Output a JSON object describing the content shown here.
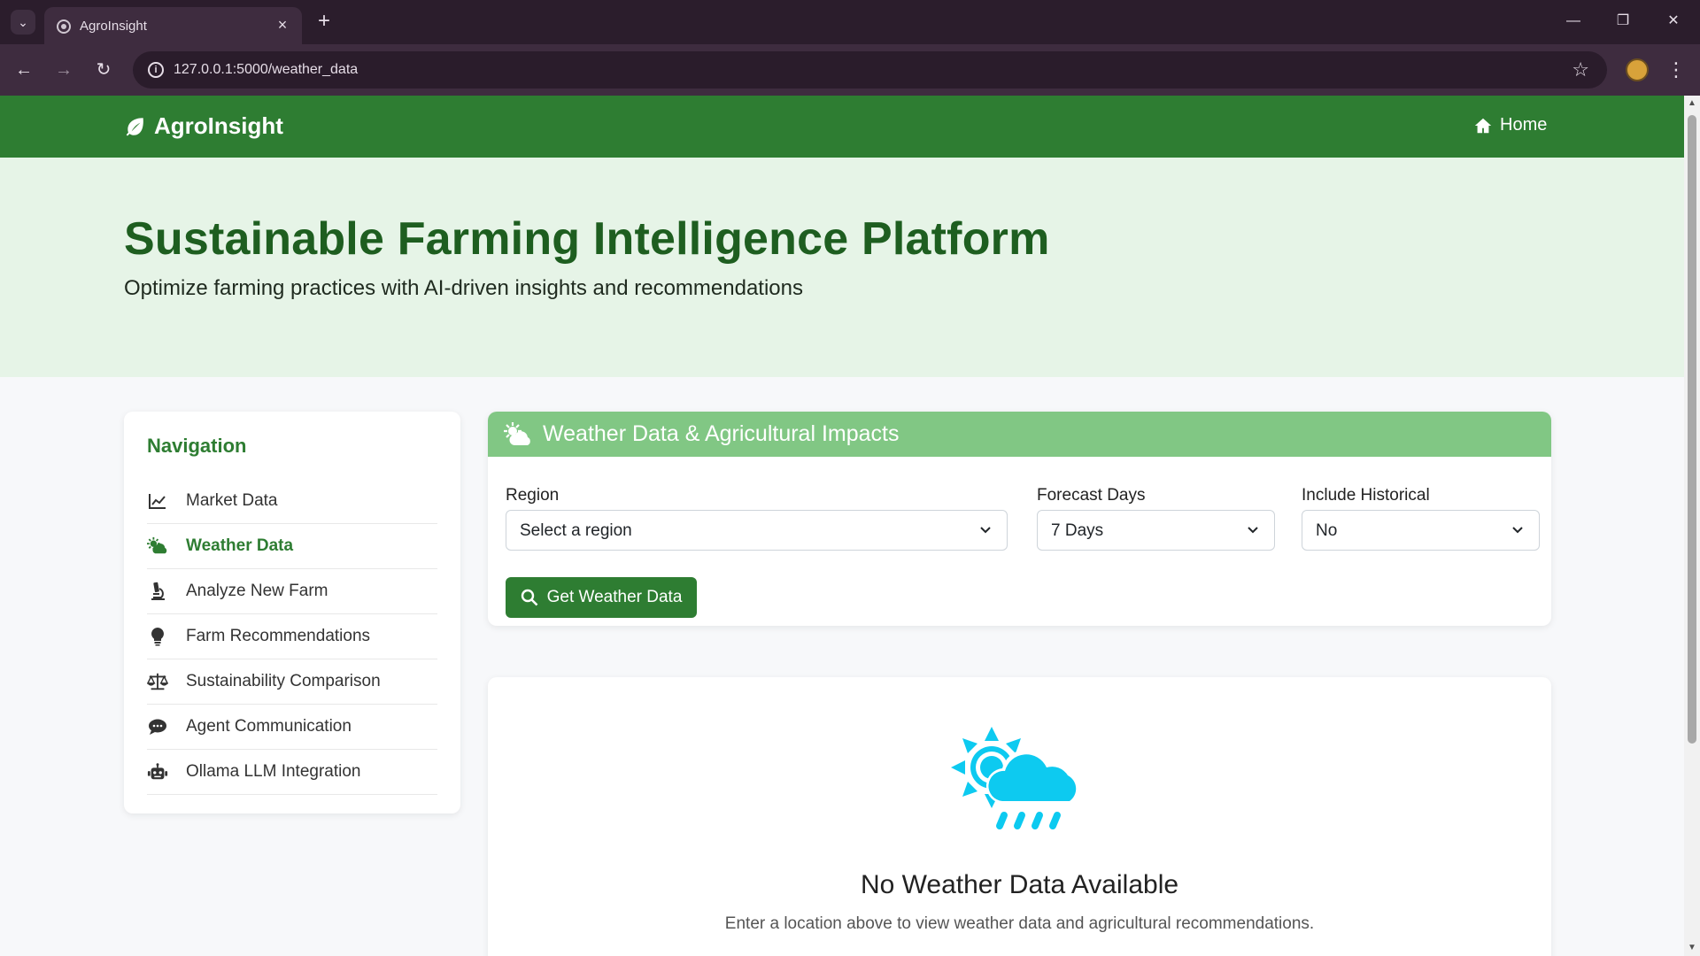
{
  "browser": {
    "tab_title": "AgroInsight",
    "url": "127.0.0.1:5000/weather_data"
  },
  "navbar": {
    "brand": "AgroInsight",
    "home_label": "Home",
    "brand_color": "#2e7d32"
  },
  "hero": {
    "title": "Sustainable Farming Intelligence Platform",
    "subtitle": "Optimize farming practices with AI-driven insights and recommendations"
  },
  "sidebar": {
    "title": "Navigation",
    "items": [
      {
        "label": "Market Data",
        "icon": "chart-line-icon",
        "active": false
      },
      {
        "label": "Weather Data",
        "icon": "cloud-sun-icon",
        "active": true
      },
      {
        "label": "Analyze New Farm",
        "icon": "microscope-icon",
        "active": false
      },
      {
        "label": "Farm Recommendations",
        "icon": "lightbulb-icon",
        "active": false
      },
      {
        "label": "Sustainability Comparison",
        "icon": "balance-scale-icon",
        "active": false
      },
      {
        "label": "Agent Communication",
        "icon": "comment-icon",
        "active": false
      },
      {
        "label": "Ollama LLM Integration",
        "icon": "robot-icon",
        "active": false
      }
    ]
  },
  "weather_form": {
    "header_title": "Weather Data & Agricultural Impacts",
    "header_color": "#81c784",
    "region": {
      "label": "Region",
      "value": "Select a region"
    },
    "forecast_days": {
      "label": "Forecast Days",
      "value": "7 Days"
    },
    "include_historical": {
      "label": "Include Historical",
      "value": "No"
    },
    "submit_label": "Get Weather Data"
  },
  "empty_state": {
    "title": "No Weather Data Available",
    "text": "Enter a location above to view weather data and agricultural recommendations.",
    "icon": "cloud-sun-rain-icon",
    "icon_color": "#0dcaf0"
  }
}
